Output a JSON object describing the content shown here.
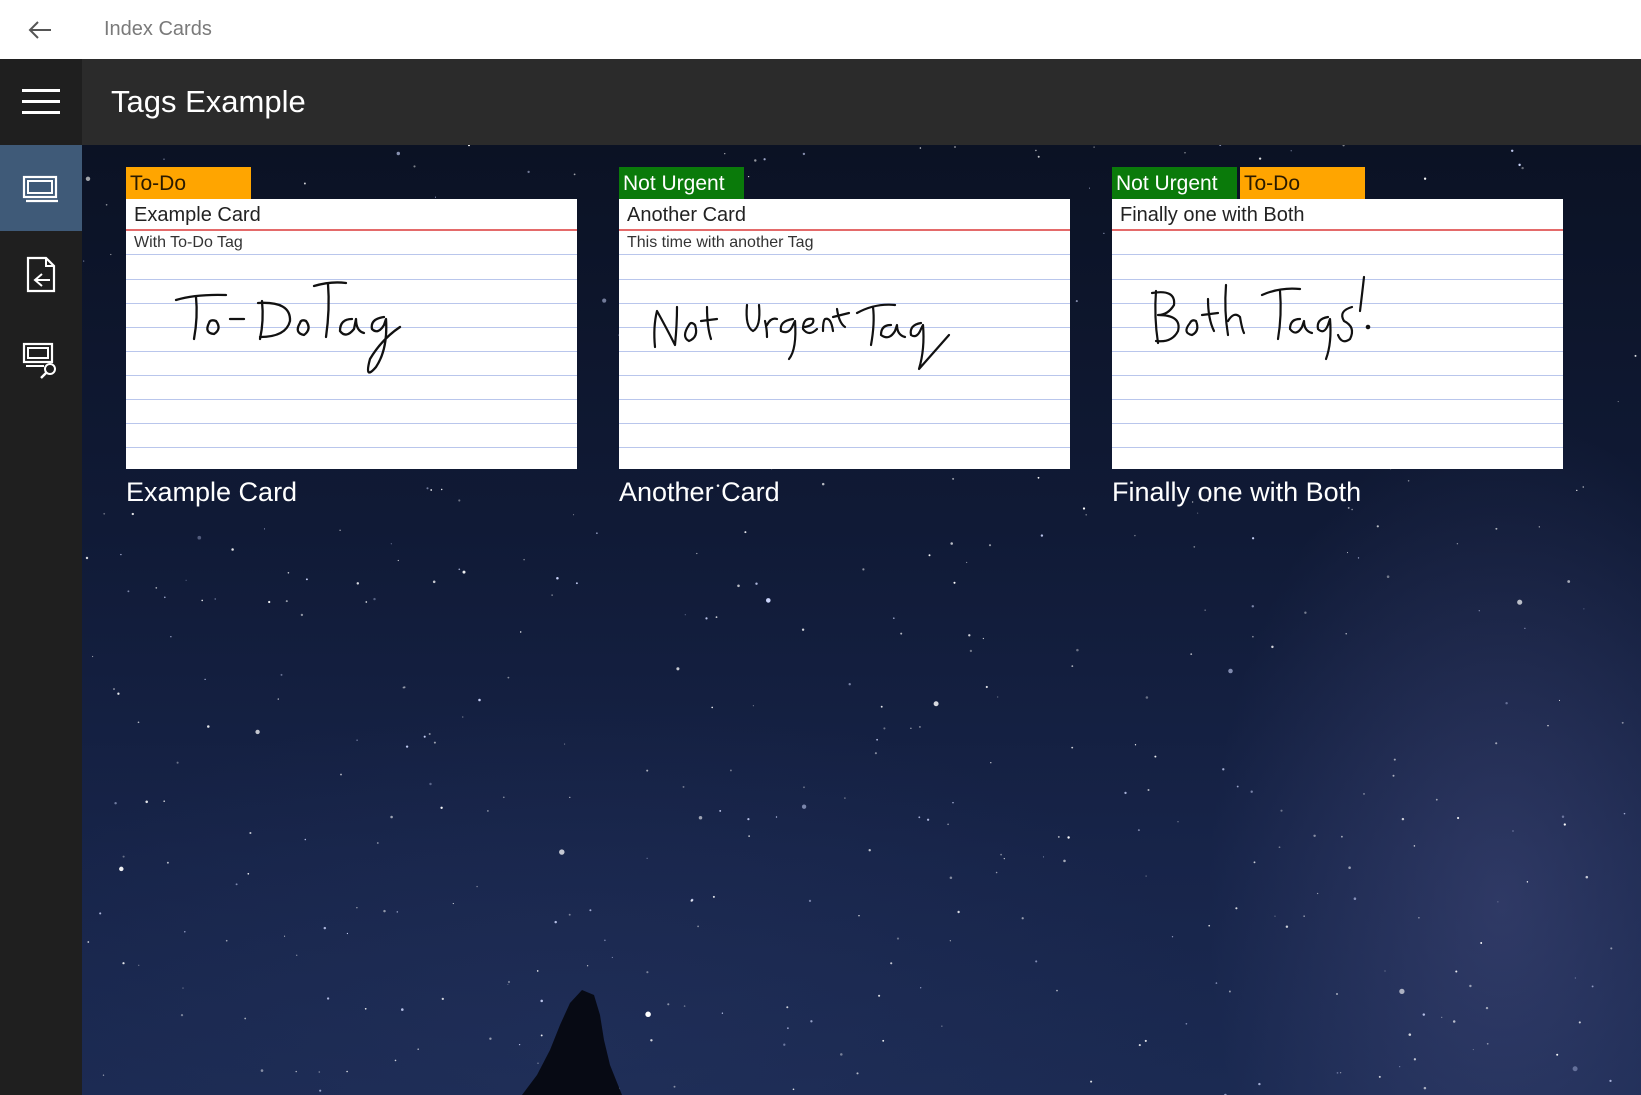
{
  "titlebar": {
    "app_title": "Index Cards",
    "back_icon": "back-arrow-icon"
  },
  "navrail": {
    "items": [
      {
        "name": "hamburger-menu-icon"
      },
      {
        "name": "cards-view-icon",
        "active": true
      },
      {
        "name": "export-icon"
      },
      {
        "name": "search-cards-icon"
      }
    ]
  },
  "header": {
    "page_title": "Tags Example"
  },
  "colors": {
    "todo_tag": "#ffa500",
    "not_urgent_tag": "#0a7a0a",
    "active_nav": "#3f5a78",
    "card_margin_line": "#e46a6a",
    "card_rule_line": "#b9c6ec"
  },
  "cards": [
    {
      "tags": [
        {
          "label": "To-Do",
          "type": "todo"
        }
      ],
      "title": "Example Card",
      "subtitle": "With To-Do Tag",
      "handwriting": "To-Do Tag",
      "caption": "Example Card"
    },
    {
      "tags": [
        {
          "label": "Not Urgent",
          "type": "urgent"
        }
      ],
      "title": "Another Card",
      "subtitle": "This time with another Tag",
      "handwriting": "Not Urgent Tag",
      "caption": "Another Card"
    },
    {
      "tags": [
        {
          "label": "Not Urgent",
          "type": "urgent"
        },
        {
          "label": "To-Do",
          "type": "todo"
        }
      ],
      "title": "Finally one with Both",
      "subtitle": "",
      "handwriting": "Both Tags!",
      "caption": "Finally one with Both"
    }
  ]
}
